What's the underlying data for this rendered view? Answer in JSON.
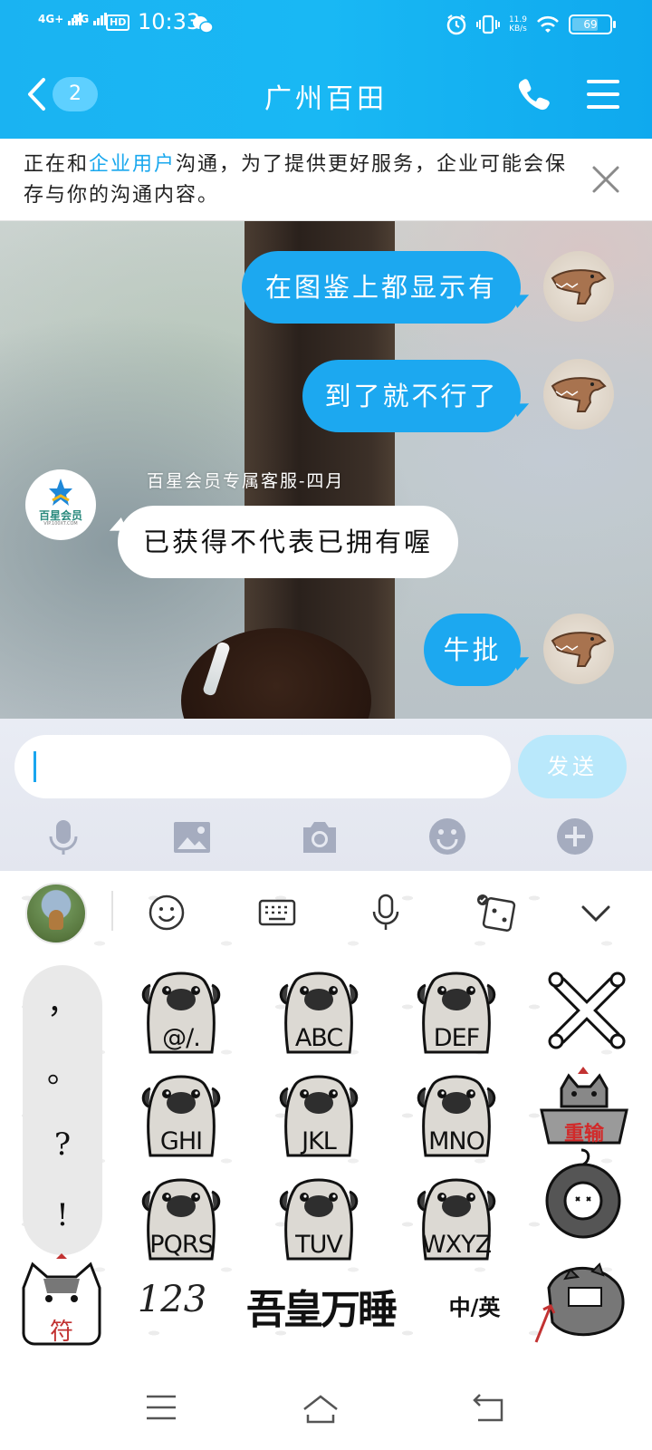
{
  "status_bar": {
    "signal1": "4G+",
    "signal2": "5G",
    "hd": "HD",
    "time": "10:33",
    "net_speed_value": "11.9",
    "net_speed_unit": "KB/s",
    "battery": "69",
    "battery_level": 0.69
  },
  "header": {
    "unread_count": "2",
    "title": "广州百田"
  },
  "notice": {
    "prefix": "正在和",
    "highlight": "企业用户",
    "suffix": "沟通，为了提供更好服务，企业可能会保存与你的沟通内容。"
  },
  "messages": [
    {
      "side": "out",
      "text": "在图鉴上都显示有"
    },
    {
      "side": "out",
      "text": "到了就不行了"
    },
    {
      "side": "in",
      "sender": "百星会员专属客服-四月",
      "text": "已获得不代表已拥有喔"
    },
    {
      "side": "out",
      "text": "牛批"
    }
  ],
  "agent_avatar": {
    "brand": "百星会员",
    "url": "VIP.100XT.COM"
  },
  "composer": {
    "input_value": "",
    "send_label": "发送"
  },
  "keyboard": {
    "punctuation": [
      "，",
      "。",
      "?",
      "!"
    ],
    "keys": [
      "@/.",
      "ABC",
      "DEF",
      "GHI",
      "JKL",
      "MNO",
      "PQRS",
      "TUV",
      "WXYZ"
    ],
    "delete_icon": "bone-cross-icon",
    "retype_label": "重输",
    "symbols_label": "符",
    "num_label": "123",
    "space_label": "吾皇万睡",
    "lang_label": "中/英"
  },
  "colors": {
    "accent": "#1ca8f0",
    "header_bg": "#16b2f2",
    "send_disabled": "#b9e8fb"
  }
}
